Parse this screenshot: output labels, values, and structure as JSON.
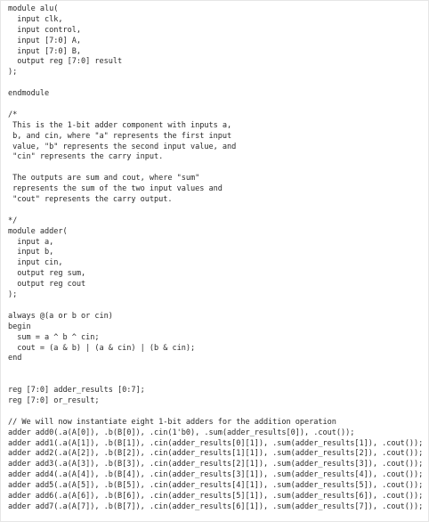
{
  "code": {
    "lines": [
      "module alu(",
      "  input clk,",
      "  input control,",
      "  input [7:0] A,",
      "  input [7:0] B,",
      "  output reg [7:0] result",
      ");",
      "",
      "endmodule",
      "",
      "/*",
      " This is the 1-bit adder component with inputs a,",
      " b, and cin, where \"a\" represents the first input",
      " value, \"b\" represents the second input value, and",
      " \"cin\" represents the carry input.",
      "",
      " The outputs are sum and cout, where \"sum\"",
      " represents the sum of the two input values and",
      " \"cout\" represents the carry output.",
      "",
      "*/",
      "module adder(",
      "  input a,",
      "  input b,",
      "  input cin,",
      "  output reg sum,",
      "  output reg cout",
      ");",
      "",
      "always @(a or b or cin)",
      "begin",
      "  sum = a ^ b ^ cin;",
      "  cout = (a & b) | (a & cin) | (b & cin);",
      "end",
      "",
      "",
      "reg [7:0] adder_results [0:7];",
      "reg [7:0] or_result;",
      "",
      "// We will now instantiate eight 1-bit adders for the addition operation",
      "adder add0(.a(A[0]), .b(B[0]), .cin(1'b0), .sum(adder_results[0]), .cout());",
      "adder add1(.a(A[1]), .b(B[1]), .cin(adder_results[0][1]), .sum(adder_results[1]), .cout());",
      "adder add2(.a(A[2]), .b(B[2]), .cin(adder_results[1][1]), .sum(adder_results[2]), .cout());",
      "adder add3(.a(A[3]), .b(B[3]), .cin(adder_results[2][1]), .sum(adder_results[3]), .cout());",
      "adder add4(.a(A[4]), .b(B[4]), .cin(adder_results[3][1]), .sum(adder_results[4]), .cout());",
      "adder add5(.a(A[5]), .b(B[5]), .cin(adder_results[4][1]), .sum(adder_results[5]), .cout());",
      "adder add6(.a(A[6]), .b(B[6]), .cin(adder_results[5][1]), .sum(adder_results[6]), .cout());",
      "adder add7(.a(A[7]), .b(B[7]), .cin(adder_results[6][1]), .sum(adder_results[7]), .cout());"
    ]
  }
}
